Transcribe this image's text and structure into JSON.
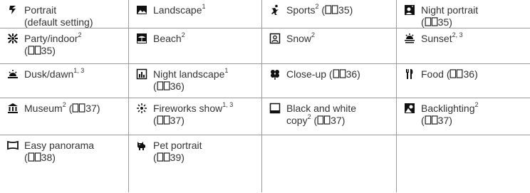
{
  "rows": [
    [
      {
        "icon": "portrait-icon",
        "line1": "Portrait",
        "sup1": "",
        "line2": "(default setting)",
        "sup2": "",
        "ref": ""
      },
      {
        "icon": "landscape-icon",
        "line1": "Landscape",
        "sup1": "1",
        "line2": "",
        "sup2": "",
        "ref": ""
      },
      {
        "icon": "sports-icon",
        "line1": "Sports",
        "sup1": "2",
        "line2": "",
        "sup2": "",
        "ref": "35"
      },
      {
        "icon": "night-portrait-icon",
        "line1": "Night portrait",
        "sup1": "",
        "line2": "",
        "sup2": "",
        "ref": "35"
      }
    ],
    [
      {
        "icon": "party-indoor-icon",
        "line1": "Party/indoor",
        "sup1": "2",
        "line2": "",
        "sup2": "",
        "ref": "35"
      },
      {
        "icon": "beach-icon",
        "line1": "Beach",
        "sup1": "2",
        "line2": "",
        "sup2": "",
        "ref": ""
      },
      {
        "icon": "snow-icon",
        "line1": "Snow",
        "sup1": "2",
        "line2": "",
        "sup2": "",
        "ref": ""
      },
      {
        "icon": "sunset-icon",
        "line1": "Sunset",
        "sup1": "2, 3",
        "line2": "",
        "sup2": "",
        "ref": ""
      }
    ],
    [
      {
        "icon": "dusk-dawn-icon",
        "line1": "Dusk/dawn",
        "sup1": "1, 3",
        "line2": "",
        "sup2": "",
        "ref": ""
      },
      {
        "icon": "night-landscape-icon",
        "line1": "Night landscape",
        "sup1": "1",
        "line2": "",
        "sup2": "",
        "ref": "36"
      },
      {
        "icon": "close-up-icon",
        "line1": "Close-up",
        "sup1": "",
        "line2": "",
        "sup2": "",
        "ref": "36"
      },
      {
        "icon": "food-icon",
        "line1": "Food",
        "sup1": "",
        "line2": "",
        "sup2": "",
        "ref": "36"
      }
    ],
    [
      {
        "icon": "museum-icon",
        "line1": "Museum",
        "sup1": "2",
        "line2": "",
        "sup2": "",
        "ref": "37"
      },
      {
        "icon": "fireworks-icon",
        "line1": "Fireworks show",
        "sup1": "1, 3",
        "line2": "",
        "sup2": "",
        "ref": "37"
      },
      {
        "icon": "black-white-copy-icon",
        "line1": "Black and white",
        "sup1": "",
        "line2": "copy",
        "sup2": "2",
        "ref": "37"
      },
      {
        "icon": "backlighting-icon",
        "line1": "Backlighting",
        "sup1": "2",
        "line2": "",
        "sup2": "",
        "ref": "37"
      }
    ],
    [
      {
        "icon": "easy-panorama-icon",
        "line1": "Easy panorama",
        "sup1": "",
        "line2": "",
        "sup2": "",
        "ref": "38"
      },
      {
        "icon": "pet-portrait-icon",
        "line1": "Pet portrait",
        "sup1": "",
        "line2": "",
        "sup2": "",
        "ref": "39"
      }
    ]
  ],
  "colors": {
    "border": "#9a9a9a",
    "text": "#333333",
    "icon": "#111111"
  }
}
